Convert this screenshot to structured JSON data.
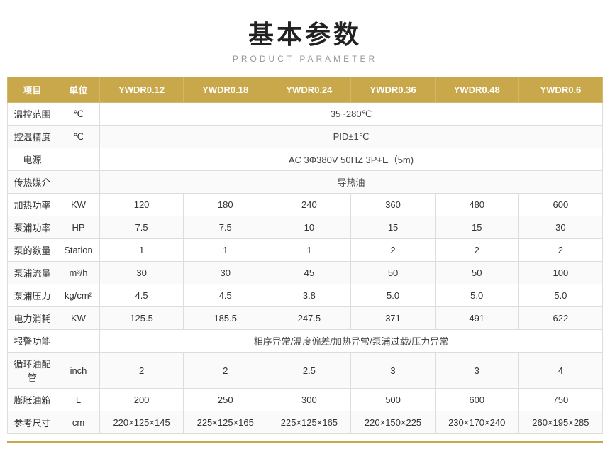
{
  "title": {
    "main": "基本参数",
    "sub": "PRODUCT PARAMETER"
  },
  "table": {
    "headers": [
      "项目",
      "单位",
      "YWDR0.12",
      "YWDR0.18",
      "YWDR0.24",
      "YWDR0.36",
      "YWDR0.48",
      "YWDR0.6"
    ],
    "rows": [
      {
        "label": "温控范围",
        "unit": "℃",
        "merged": true,
        "merged_value": "35~280℃",
        "values": []
      },
      {
        "label": "控温精度",
        "unit": "℃",
        "merged": true,
        "merged_value": "PID±1℃",
        "values": []
      },
      {
        "label": "电源",
        "unit": "",
        "merged": true,
        "merged_value": "AC 3Φ380V 50HZ  3P+E（5m)",
        "values": []
      },
      {
        "label": "传热媒介",
        "unit": "",
        "merged": true,
        "merged_value": "导热油",
        "values": []
      },
      {
        "label": "加热功率",
        "unit": "KW",
        "merged": false,
        "values": [
          "120",
          "180",
          "240",
          "360",
          "480",
          "600"
        ]
      },
      {
        "label": "泵浦功率",
        "unit": "HP",
        "merged": false,
        "values": [
          "7.5",
          "7.5",
          "10",
          "15",
          "15",
          "30"
        ]
      },
      {
        "label": "泵的数量",
        "unit": "Station",
        "merged": false,
        "values": [
          "1",
          "1",
          "1",
          "2",
          "2",
          "2"
        ]
      },
      {
        "label": "泵浦流量",
        "unit": "m³/h",
        "merged": false,
        "values": [
          "30",
          "30",
          "45",
          "50",
          "50",
          "100"
        ]
      },
      {
        "label": "泵浦压力",
        "unit": "kg/cm²",
        "merged": false,
        "values": [
          "4.5",
          "4.5",
          "3.8",
          "5.0",
          "5.0",
          "5.0"
        ]
      },
      {
        "label": "电力消耗",
        "unit": "KW",
        "merged": false,
        "values": [
          "125.5",
          "185.5",
          "247.5",
          "371",
          "491",
          "622"
        ]
      },
      {
        "label": "报警功能",
        "unit": "",
        "merged": true,
        "merged_value": "相序异常/温度偏差/加热异常/泵浦过载/压力异常",
        "values": []
      },
      {
        "label": "循环油配管",
        "unit": "inch",
        "merged": false,
        "values": [
          "2",
          "2",
          "2.5",
          "3",
          "3",
          "4"
        ]
      },
      {
        "label": "膨胀油箱",
        "unit": "L",
        "merged": false,
        "values": [
          "200",
          "250",
          "300",
          "500",
          "600",
          "750"
        ]
      },
      {
        "label": "参考尺寸",
        "unit": "cm",
        "merged": false,
        "values": [
          "220×125×145",
          "225×125×165",
          "225×125×165",
          "220×150×225",
          "230×170×240",
          "260×195×285"
        ]
      }
    ]
  }
}
